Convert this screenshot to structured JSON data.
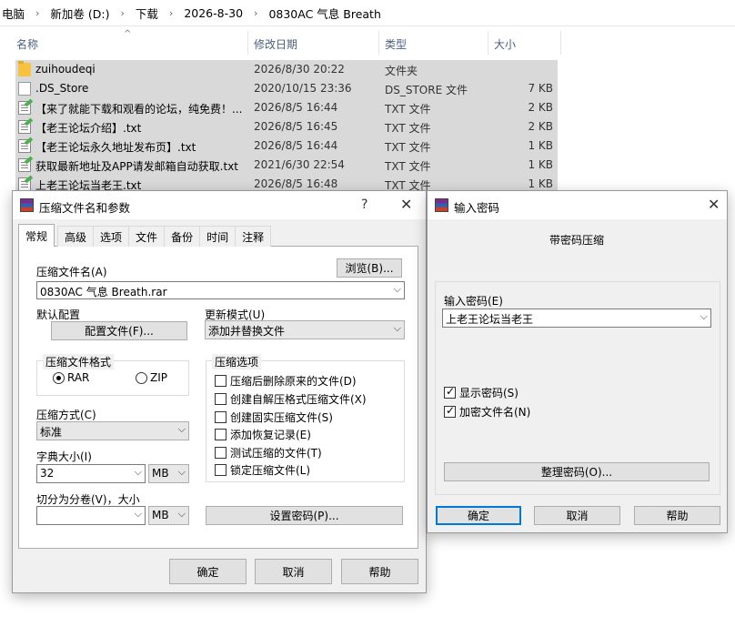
{
  "explorer": {
    "breadcrumb": [
      "电脑",
      "新加卷 (D:)",
      "下载",
      "2026-8-30",
      "0830AC 气息 Breath"
    ],
    "columns": {
      "name": "名称",
      "date": "修改日期",
      "type": "类型",
      "size": "大小"
    },
    "files": [
      {
        "icon": "folder-icon",
        "name": "zuihoudeqi",
        "date": "2026/8/30 20:22",
        "type": "文件夹",
        "size": ""
      },
      {
        "icon": "file-icon",
        "name": ".DS_Store",
        "date": "2020/10/15 23:36",
        "type": "DS_STORE 文件",
        "size": "7 KB"
      },
      {
        "icon": "text-file-icon",
        "name": "【来了就能下载和观看的论坛，纯免费！...",
        "date": "2026/8/5 16:44",
        "type": "TXT 文件",
        "size": "2 KB"
      },
      {
        "icon": "text-file-icon",
        "name": "【老王论坛介绍】.txt",
        "date": "2026/8/5 16:45",
        "type": "TXT 文件",
        "size": "2 KB"
      },
      {
        "icon": "text-file-icon",
        "name": "【老王论坛永久地址发布页】.txt",
        "date": "2026/8/5 16:44",
        "type": "TXT 文件",
        "size": "1 KB"
      },
      {
        "icon": "text-file-icon",
        "name": "获取最新地址及APP请发邮箱自动获取.txt",
        "date": "2021/6/30 22:54",
        "type": "TXT 文件",
        "size": "1 KB"
      },
      {
        "icon": "text-file-icon",
        "name": "上老王论坛当老王.txt",
        "date": "2026/8/5 16:48",
        "type": "TXT 文件",
        "size": "1 KB"
      }
    ]
  },
  "archive_dialog": {
    "title": "压缩文件名和参数",
    "help_glyph": "?",
    "close_glyph": "✕",
    "tabs": [
      "常规",
      "高级",
      "选项",
      "文件",
      "备份",
      "时间",
      "注释"
    ],
    "archive_name_label": "压缩文件名(A)",
    "browse_button": "浏览(B)...",
    "archive_name_value": "0830AC 气息 Breath.rar",
    "default_profile_label": "默认配置",
    "profiles_button": "配置文件(F)...",
    "update_mode_label": "更新模式(U)",
    "update_mode_value": "添加并替换文件",
    "format_group": "压缩文件格式",
    "format_rar": "RAR",
    "format_zip": "ZIP",
    "options_group": "压缩选项",
    "options": [
      {
        "label": "压缩后删除原来的文件(D)",
        "checked": false
      },
      {
        "label": "创建自解压格式压缩文件(X)",
        "checked": false
      },
      {
        "label": "创建固实压缩文件(S)",
        "checked": false
      },
      {
        "label": "添加恢复记录(E)",
        "checked": false
      },
      {
        "label": "测试压缩的文件(T)",
        "checked": false
      },
      {
        "label": "锁定压缩文件(L)",
        "checked": false
      }
    ],
    "method_label": "压缩方式(C)",
    "method_value": "标准",
    "dict_label": "字典大小(I)",
    "dict_value": "32",
    "dict_unit": "MB",
    "split_label": "切分为分卷(V)，大小",
    "split_value": "",
    "split_unit": "MB",
    "set_password_button": "设置密码(P)...",
    "ok_button": "确定",
    "cancel_button": "取消",
    "help_button": "帮助"
  },
  "password_dialog": {
    "title": "输入密码",
    "close_glyph": "✕",
    "heading": "带密码压缩",
    "password_label": "输入密码(E)",
    "password_value": "上老王论坛当老王",
    "show_password": {
      "label": "显示密码(S)",
      "checked": true
    },
    "encrypt_names": {
      "label": "加密文件名(N)",
      "checked": true
    },
    "organize_button": "整理密码(O)...",
    "ok_button": "确定",
    "cancel_button": "取消",
    "help_button": "帮助"
  }
}
